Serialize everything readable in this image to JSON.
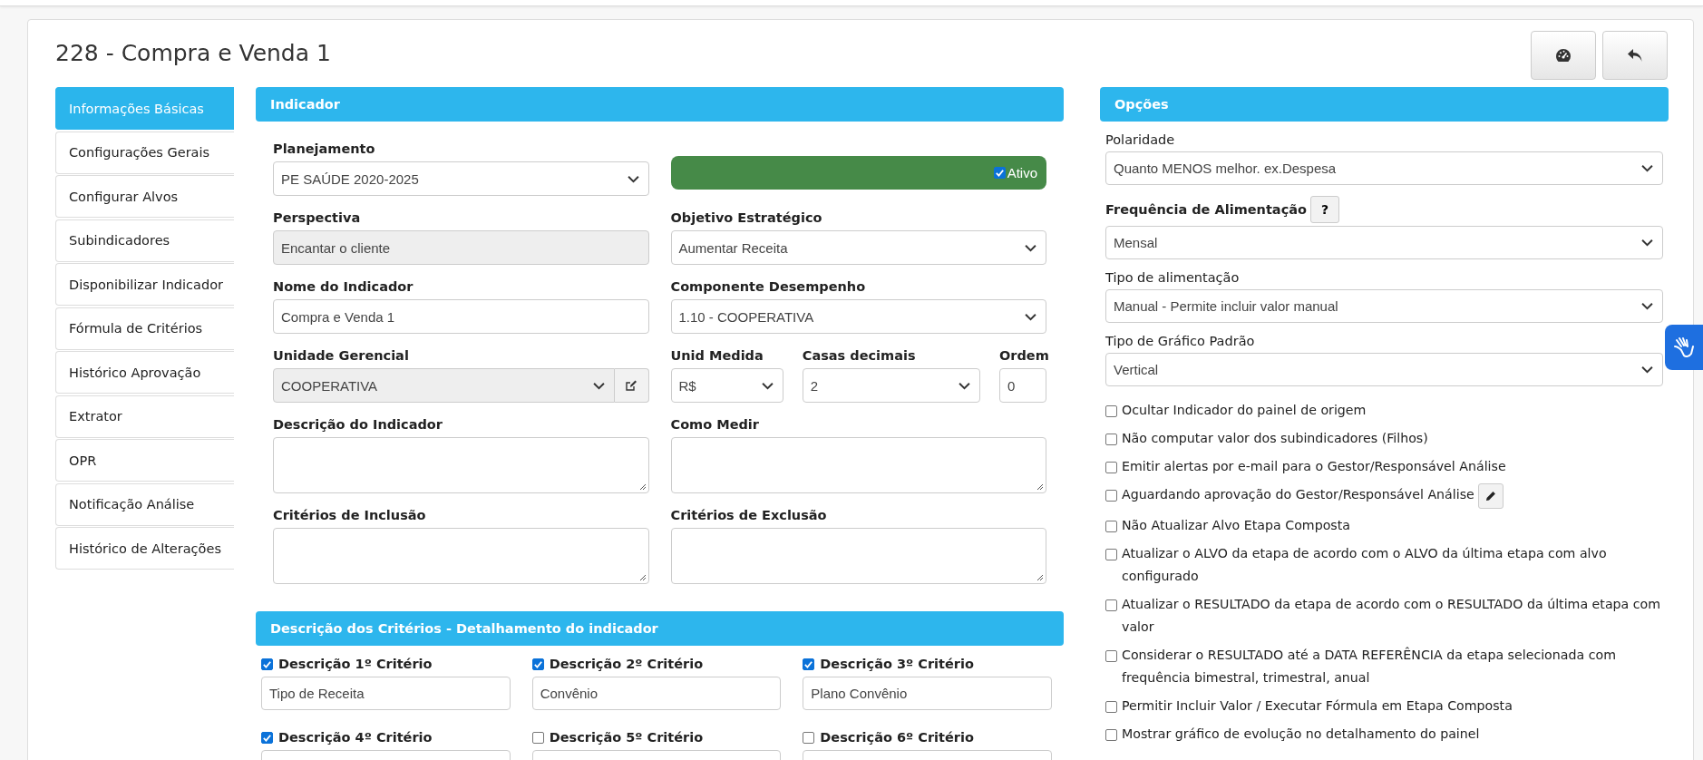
{
  "title": "228 - Compra e Venda 1",
  "sidebar": {
    "items": [
      {
        "label": "Informações Básicas",
        "selected": true
      },
      {
        "label": "Configurações Gerais",
        "selected": false
      },
      {
        "label": "Configurar Alvos",
        "selected": false
      },
      {
        "label": "Subindicadores",
        "selected": false
      },
      {
        "label": "Disponibilizar Indicador",
        "selected": false
      },
      {
        "label": "Fórmula de Critérios",
        "selected": false
      },
      {
        "label": "Histórico Aprovação",
        "selected": false
      },
      {
        "label": "Extrator",
        "selected": false
      },
      {
        "label": "OPR",
        "selected": false
      },
      {
        "label": "Notificação Análise",
        "selected": false
      },
      {
        "label": "Histórico de Alterações",
        "selected": false
      }
    ]
  },
  "indicador": {
    "title": "Indicador",
    "planejamento": {
      "label": "Planejamento",
      "value": "PE SAÚDE 2020-2025",
      "disabled": false
    },
    "ativo": {
      "label": "Ativo",
      "checked": true
    },
    "perspectiva": {
      "label": "Perspectiva",
      "value": "Encantar o cliente",
      "disabled": true
    },
    "objetivo": {
      "label": "Objetivo Estratégico",
      "value": "Aumentar Receita",
      "disabled": false
    },
    "nome": {
      "label": "Nome do Indicador",
      "value": "Compra e Venda 1",
      "disabled": false
    },
    "componente": {
      "label": "Componente Desempenho",
      "value": "1.10 - COOPERATIVA",
      "disabled": false
    },
    "unidade": {
      "label": "Unidade Gerencial",
      "value": "COOPERATIVA",
      "disabled": true
    },
    "unid_medida": {
      "label": "Unid Medida",
      "value": "R$",
      "disabled": false
    },
    "casas_decimais": {
      "label": "Casas decimais",
      "value": "2",
      "disabled": false
    },
    "ordem": {
      "label": "Ordem",
      "value": "0",
      "disabled": false
    },
    "descricao": {
      "label": "Descrição do Indicador",
      "disabled": false
    },
    "como_medir": {
      "label": "Como Medir",
      "disabled": false
    },
    "inclusao": {
      "label": "Critérios de Inclusão",
      "disabled": false
    },
    "exclusao": {
      "label": "Critérios de Exclusão",
      "disabled": false
    }
  },
  "criterios": {
    "title": "Descrição dos Critérios - Detalhamento do indicador",
    "items": [
      {
        "label": "Descrição 1º Critério",
        "checked": true,
        "value": "Tipo de Receita"
      },
      {
        "label": "Descrição 2º Critério",
        "checked": true,
        "value": "Convênio"
      },
      {
        "label": "Descrição 3º Critério",
        "checked": true,
        "value": "Plano Convênio"
      },
      {
        "label": "Descrição 4º Critério",
        "checked": true
      },
      {
        "label": "Descrição 5º Critério",
        "checked": false
      },
      {
        "label": "Descrição 6º Critério",
        "checked": false
      }
    ]
  },
  "opcoes": {
    "title": "Opções",
    "polaridade": {
      "label": "Polaridade",
      "value": "Quanto MENOS melhor. ex.Despesa"
    },
    "frequencia": {
      "label": "Frequência de Alimentação",
      "help": "?",
      "value": "Mensal"
    },
    "tipo_alimentacao": {
      "label": "Tipo de alimentação",
      "value": "Manual - Permite incluir valor manual"
    },
    "tipo_grafico": {
      "label": "Tipo de Gráfico Padrão",
      "value": "Vertical"
    },
    "checks": [
      {
        "label": "Ocultar Indicador do painel de origem",
        "checked": false
      },
      {
        "label": "Não computar valor dos subindicadores (Filhos)",
        "checked": false
      },
      {
        "label": "Emitir alertas por e-mail para o Gestor/Responsável Análise",
        "checked": false
      },
      {
        "label": "Aguardando aprovação do Gestor/Responsável Análise",
        "checked": false,
        "edit_button": true
      },
      {
        "label": "Não Atualizar Alvo Etapa Composta",
        "checked": false
      },
      {
        "label": "Atualizar o ALVO da etapa de acordo com o ALVO da última etapa com alvo configurado",
        "checked": false
      },
      {
        "label": "Atualizar o RESULTADO da etapa de acordo com o RESULTADO da última etapa com valor",
        "checked": false
      },
      {
        "label": "Considerar o RESULTADO até a DATA REFERÊNCIA da etapa selecionada com frequência bimestral, trimestral, anual",
        "checked": false
      },
      {
        "label": "Permitir Incluir Valor / Executar Fórmula em Etapa Composta",
        "checked": false
      },
      {
        "label": "Mostrar gráfico de evolução no detalhamento do painel",
        "checked": false
      }
    ]
  }
}
